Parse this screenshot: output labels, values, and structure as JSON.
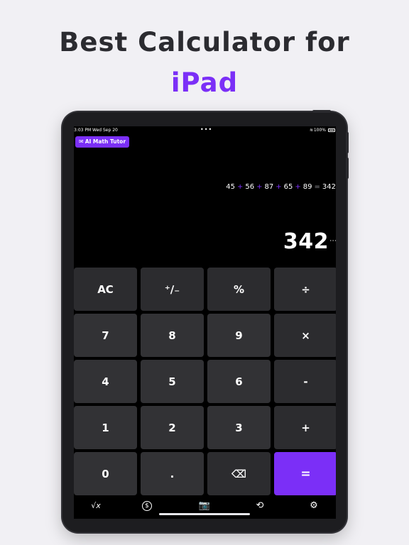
{
  "headline": {
    "line1": "Best Calculator for",
    "line2": "iPad"
  },
  "status_bar": {
    "time": "3:03 PM",
    "date": "Wed Sep 20",
    "dots": "•••",
    "wifi": "≋",
    "battery": "100%"
  },
  "tutor_button": {
    "icon": "chat-bubbles-icon",
    "label": "AI Math Tutor"
  },
  "display": {
    "expression": [
      {
        "t": "45",
        "k": "num"
      },
      {
        "t": "+",
        "k": "op"
      },
      {
        "t": "56",
        "k": "num"
      },
      {
        "t": "+",
        "k": "op"
      },
      {
        "t": "87",
        "k": "num"
      },
      {
        "t": "+",
        "k": "op"
      },
      {
        "t": "65",
        "k": "num"
      },
      {
        "t": "+",
        "k": "op"
      },
      {
        "t": "89",
        "k": "num"
      },
      {
        "t": "=",
        "k": "eq"
      },
      {
        "t": "342",
        "k": "num"
      }
    ],
    "result": "342",
    "menu": "⋮"
  },
  "keys": [
    {
      "label": "AC",
      "kind": "fn",
      "name": "clear-button"
    },
    {
      "label": "⁺∕₋",
      "kind": "fn",
      "name": "sign-toggle-button"
    },
    {
      "label": "%",
      "kind": "fn",
      "name": "percent-button"
    },
    {
      "label": "÷",
      "kind": "op",
      "name": "divide-button"
    },
    {
      "label": "7",
      "kind": "num",
      "name": "digit-7-button"
    },
    {
      "label": "8",
      "kind": "num",
      "name": "digit-8-button"
    },
    {
      "label": "9",
      "kind": "num",
      "name": "digit-9-button"
    },
    {
      "label": "×",
      "kind": "op",
      "name": "multiply-button"
    },
    {
      "label": "4",
      "kind": "num",
      "name": "digit-4-button"
    },
    {
      "label": "5",
      "kind": "num",
      "name": "digit-5-button"
    },
    {
      "label": "6",
      "kind": "num",
      "name": "digit-6-button"
    },
    {
      "label": "-",
      "kind": "op",
      "name": "subtract-button"
    },
    {
      "label": "1",
      "kind": "num",
      "name": "digit-1-button"
    },
    {
      "label": "2",
      "kind": "num",
      "name": "digit-2-button"
    },
    {
      "label": "3",
      "kind": "num",
      "name": "digit-3-button"
    },
    {
      "label": "+",
      "kind": "op",
      "name": "add-button"
    },
    {
      "label": "0",
      "kind": "num",
      "name": "digit-0-button"
    },
    {
      "label": ".",
      "kind": "num",
      "name": "decimal-button"
    },
    {
      "label": "⌫",
      "kind": "fn",
      "name": "backspace-button"
    },
    {
      "label": "=",
      "kind": "eq",
      "name": "equals-button"
    }
  ],
  "tabs": [
    {
      "icon": "√x",
      "name": "square-root-icon"
    },
    {
      "icon": "$",
      "name": "currency-icon"
    },
    {
      "icon": "📷",
      "name": "camera-icon"
    },
    {
      "icon": "⟲",
      "name": "history-icon"
    },
    {
      "icon": "⚙",
      "name": "settings-icon"
    }
  ],
  "colors": {
    "accent": "#7b2ff7",
    "background": "#f1f0f4",
    "key_number": "#323235",
    "key_function": "#2c2c2f"
  }
}
